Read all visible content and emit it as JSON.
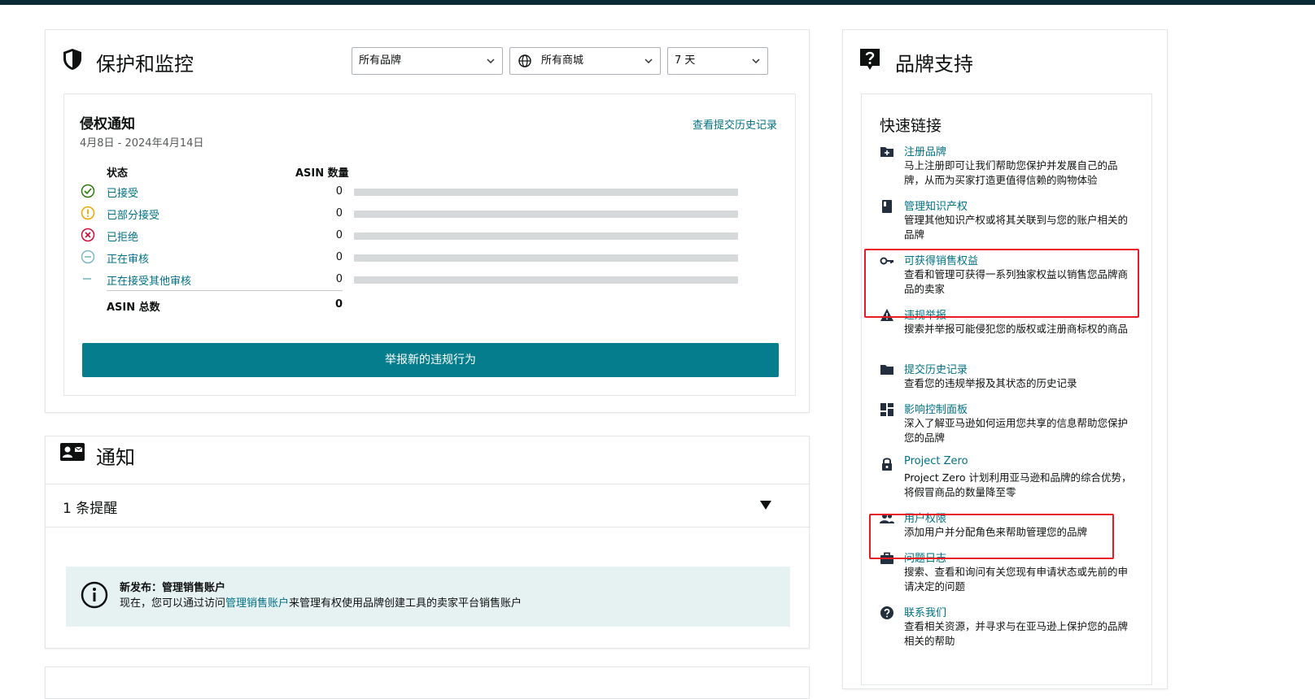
{
  "protection": {
    "title": "保护和监控",
    "filters": {
      "brand": "所有品牌",
      "marketplace": "所有商城",
      "period": "7 天"
    },
    "infringement": {
      "title": "侵权通知",
      "date_range": "4月8日 - 2024年4月14日",
      "history_link": "查看提交历史记录",
      "col_status": "状态",
      "col_asin": "ASIN 数量",
      "rows": [
        {
          "label": "已接受",
          "count": "0",
          "icon": "check-circle-icon",
          "color": "#2b7a0b"
        },
        {
          "label": "已部分接受",
          "count": "0",
          "icon": "warning-circle-icon",
          "color": "#f0a500"
        },
        {
          "label": "已拒绝",
          "count": "0",
          "icon": "x-circle-icon",
          "color": "#cc0c39"
        },
        {
          "label": "正在审核",
          "count": "0",
          "icon": "minus-circle-icon",
          "color": "#7fb7c0"
        },
        {
          "label": "正在接受其他审核",
          "count": "0",
          "icon": "dash-icon",
          "color": "#7fb7c0"
        }
      ],
      "total_label": "ASIN 总数",
      "total_value": "0",
      "report_button": "举报新的违规行为"
    }
  },
  "notifications": {
    "title": "通知",
    "reminder_count": "1 条提醒",
    "info": {
      "title": "新发布：管理销售账户",
      "text_before": "现在，您可以通过访问",
      "link": "管理销售账户",
      "text_after": "来管理有权使用品牌创建工具的卖家平台销售账户"
    }
  },
  "support": {
    "title": "品牌支持",
    "quick_links_title": "快速链接",
    "items": [
      {
        "label": "注册品牌",
        "desc": "马上注册即可让我们帮助您保护并发展自己的品牌，从而为买家打造更值得信赖的购物体验",
        "icon": "folder-plus-icon"
      },
      {
        "label": "管理知识产权",
        "desc": "管理其他知识产权或将其关联到与您的账户相关的品牌",
        "icon": "book-icon"
      },
      {
        "label": "可获得销售权益",
        "desc": "查看和管理可获得一系列独家权益以销售您品牌商品的卖家",
        "icon": "key-icon"
      },
      {
        "label": "违规举报",
        "desc": "搜索并举报可能侵犯您的版权或注册商标权的商品",
        "icon": "warning-icon"
      },
      {
        "label": "提交历史记录",
        "desc": "查看您的违规举报及其状态的历史记录",
        "icon": "folder-icon"
      },
      {
        "label": "影响控制面板",
        "desc": "深入了解亚马逊如何运用您共享的信息帮助您保护您的品牌",
        "icon": "dashboard-icon"
      },
      {
        "label": "Project Zero",
        "desc": "Project Zero 计划利用亚马逊和品牌的综合优势，将假冒商品的数量降至零",
        "icon": "lock-icon"
      },
      {
        "label": "用户权限",
        "desc": "添加用户并分配角色来帮助管理您的品牌",
        "icon": "users-icon"
      },
      {
        "label": "问题日志",
        "desc": "搜索、查看和询问有关您现有申请状态或先前的申请决定的问题",
        "icon": "briefcase-icon"
      },
      {
        "label": "联系我们",
        "desc": "查看相关资源，并寻求与在亚马逊上保护您的品牌相关的帮助",
        "icon": "help-circle-icon"
      }
    ]
  }
}
